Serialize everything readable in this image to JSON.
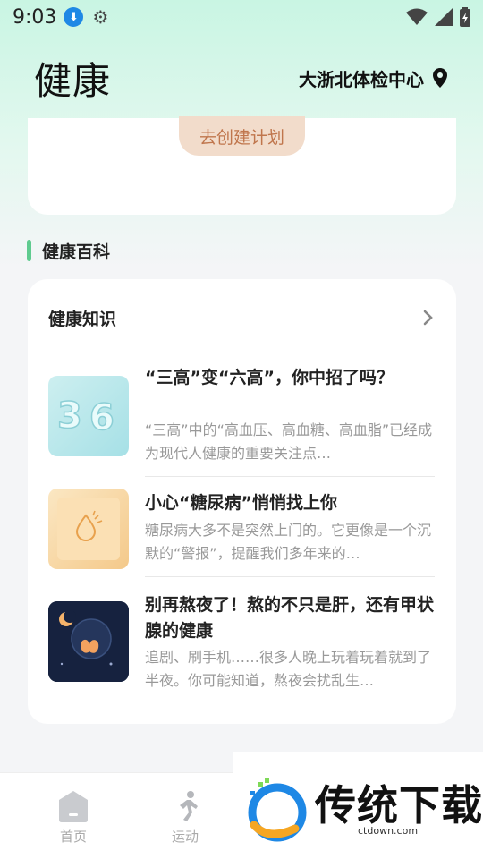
{
  "status_bar": {
    "time": "9:03"
  },
  "header": {
    "title": "健康",
    "location": "大浙北体检中心"
  },
  "plan_card": {
    "create_plan_label": "去创建计划"
  },
  "section": {
    "title": "健康百科"
  },
  "knowledge": {
    "title": "健康知识",
    "articles": [
      {
        "title": "“三高”变“六高”，你中招了吗？",
        "desc": "“三高”中的“高血压、高血糖、高血脂”已经成为现代人健康的重要关注点…"
      },
      {
        "title": "小心“糖尿病”悄悄找上你",
        "desc": "糖尿病大多不是突然上门的。它更像是一个沉默的“警报”，提醒我们多年来的…"
      },
      {
        "title": "别再熬夜了！熬的不只是肝，还有甲状腺的健康",
        "desc": "追剧、刷手机……很多人晚上玩着玩着就到了半夜。你可能知道，熬夜会扰乱生…"
      }
    ]
  },
  "bottom_nav": {
    "home": "首页",
    "sport": "运动"
  },
  "watermark": {
    "brand": "传统下载",
    "site": "ctdown.com"
  },
  "colors": {
    "accent": "#5fcb8f",
    "plan_button": "#f2dccb",
    "plan_text": "#c0764d"
  }
}
